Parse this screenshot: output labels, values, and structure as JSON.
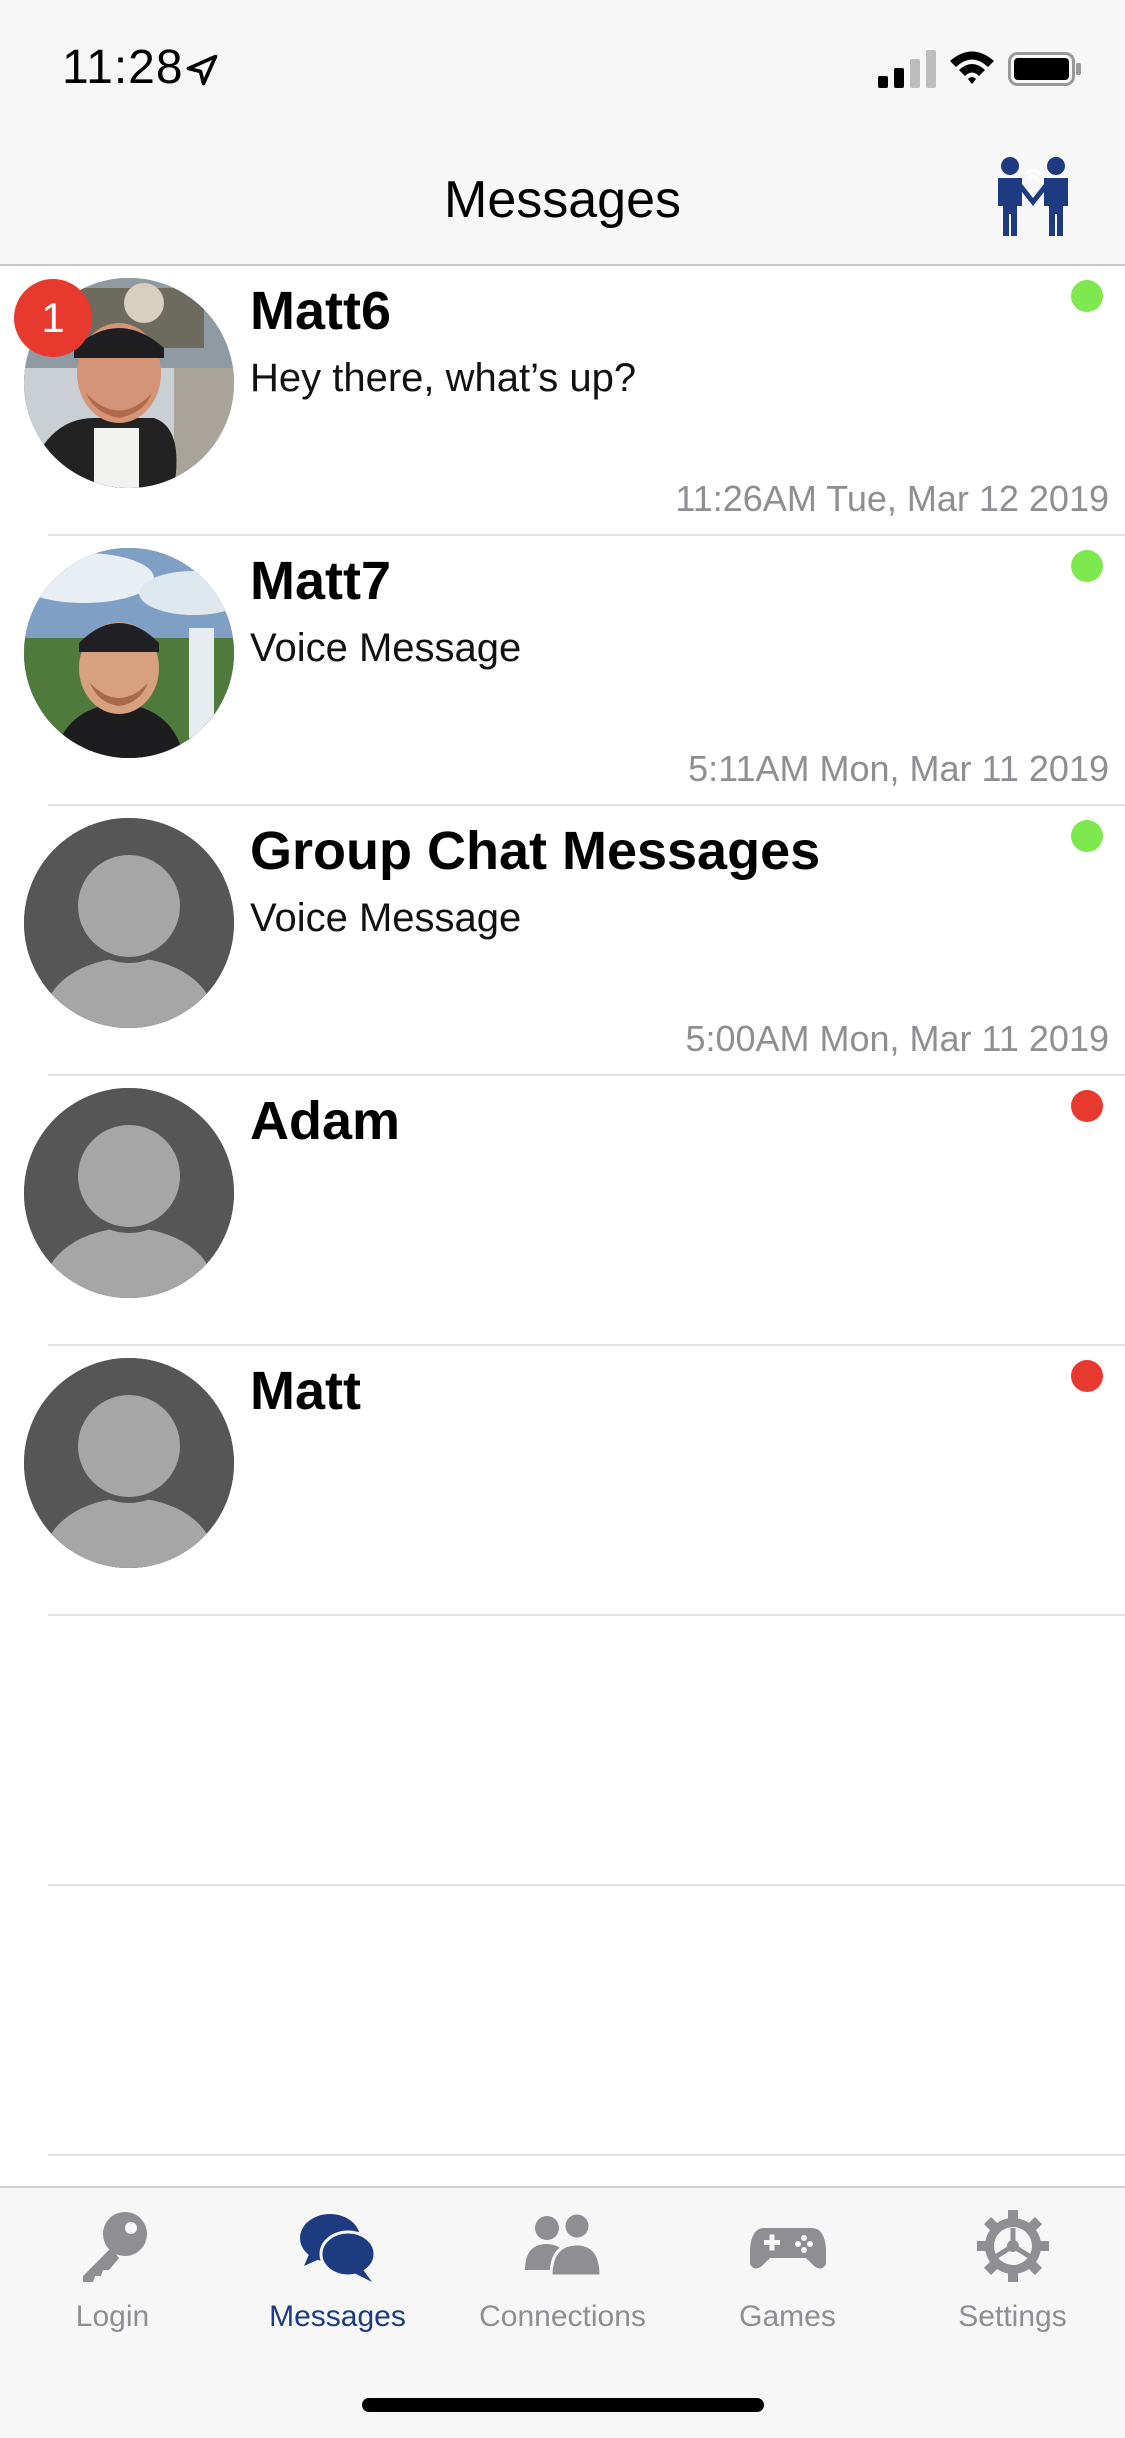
{
  "status_bar": {
    "time": "11:28"
  },
  "nav": {
    "title": "Messages",
    "right_icon": "connections-people-icon"
  },
  "colors": {
    "online": "#7ee84f",
    "offline": "#e8392e",
    "accent": "#1e3b82",
    "badge": "#e8392e"
  },
  "messages": [
    {
      "name": "Matt6",
      "preview": "Hey there, what’s up?",
      "timestamp": "11:26AM Tue, Mar 12 2019",
      "status": "online",
      "unread": "1",
      "avatar": "photo"
    },
    {
      "name": "Matt7",
      "preview": "Voice Message",
      "timestamp": "5:11AM Mon, Mar 11 2019",
      "status": "online",
      "avatar": "photo"
    },
    {
      "name": "Group Chat Messages",
      "preview": "Voice Message",
      "timestamp": "5:00AM Mon, Mar 11 2019",
      "status": "online",
      "avatar": "placeholder"
    },
    {
      "name": "Adam",
      "status": "offline",
      "avatar": "placeholder"
    },
    {
      "name": "Matt",
      "status": "offline",
      "avatar": "placeholder"
    }
  ],
  "tabs": [
    {
      "label": "Login",
      "icon": "key-icon"
    },
    {
      "label": "Messages",
      "icon": "chat-bubbles-icon",
      "active": true
    },
    {
      "label": "Connections",
      "icon": "people-icon"
    },
    {
      "label": "Games",
      "icon": "gamepad-icon"
    },
    {
      "label": "Settings",
      "icon": "gear-icon"
    }
  ]
}
